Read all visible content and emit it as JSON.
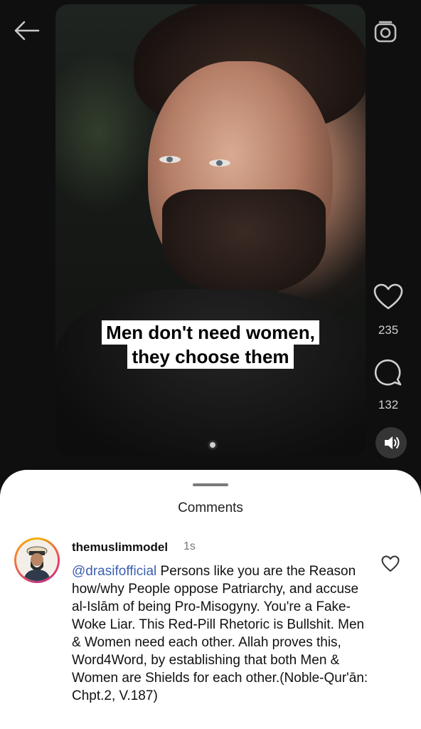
{
  "reel": {
    "caption_line1": "Men don't need women,",
    "caption_line2": "they choose them",
    "likes": "235",
    "comments_count": "132"
  },
  "icons": {
    "back": "back-arrow-icon",
    "camera": "camera-icon",
    "like": "heart-icon",
    "comment": "comment-bubble-icon",
    "sound": "speaker-icon"
  },
  "comments_sheet": {
    "title": "Comments",
    "items": [
      {
        "username": "themuslimmodel",
        "time": "1s",
        "mention": "@drasifofficial",
        "text": " Persons like you are the Reason how/why People oppose Patriarchy, and accuse al-Islām of being Pro-Misogyny. You're a Fake-Woke Liar. This Red-Pill Rhetoric is Bullshit. Men & Women need each other. Allah proves this, Word4Word, by establishing that both Men & Women are Shields for each other.(Noble-Qur'ān: Chpt.2, V.187)"
      }
    ]
  },
  "colors": {
    "background": "#0f0f10",
    "sheet": "#ffffff",
    "mention": "#3b5fb0",
    "icon": "#cfcfcf"
  }
}
